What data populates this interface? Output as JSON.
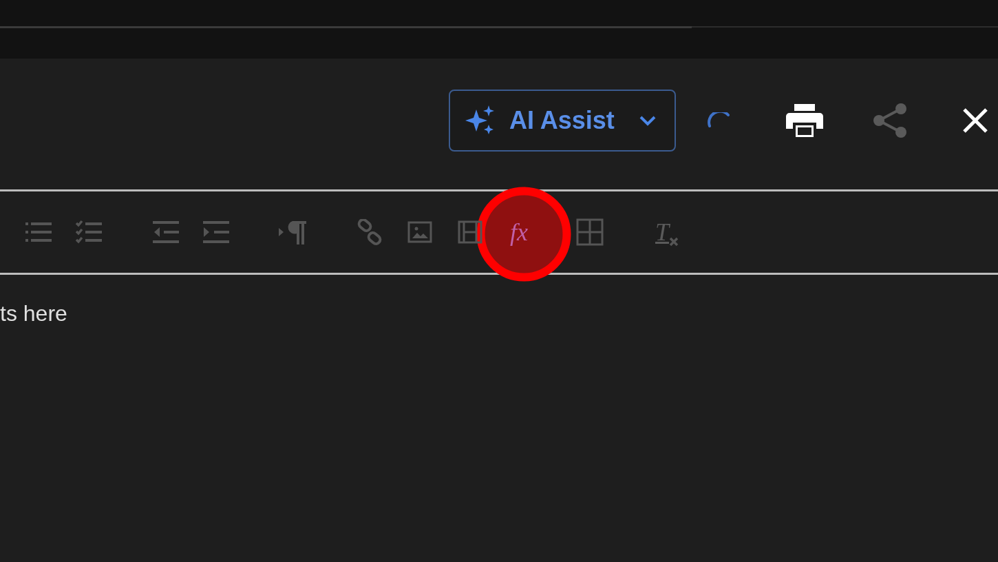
{
  "header": {
    "ai_assist": {
      "label": "AI Assist"
    },
    "loading": true,
    "actions": [
      {
        "kind": "print",
        "disabled": false
      },
      {
        "kind": "share",
        "disabled": true
      },
      {
        "kind": "close",
        "disabled": false
      }
    ]
  },
  "toolbar": [
    {
      "kind": "bullet-list",
      "highlighted": false
    },
    {
      "kind": "checklist",
      "highlighted": false
    },
    {
      "kind": "outdent",
      "highlighted": false
    },
    {
      "kind": "indent",
      "highlighted": false
    },
    {
      "kind": "paragraph-direction",
      "highlighted": false
    },
    {
      "kind": "link",
      "highlighted": false
    },
    {
      "kind": "image",
      "highlighted": false
    },
    {
      "kind": "video",
      "highlighted": false
    },
    {
      "kind": "formula",
      "glyph": "fx",
      "highlighted": true
    },
    {
      "kind": "table",
      "highlighted": false
    },
    {
      "kind": "clear-format",
      "glyph": "T",
      "highlighted": false
    }
  ],
  "editor": {
    "text": "ts here"
  }
}
